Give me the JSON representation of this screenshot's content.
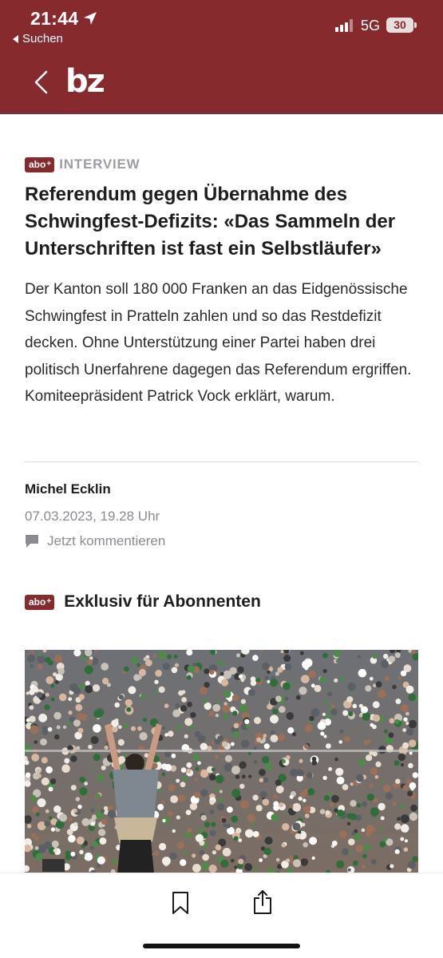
{
  "status_bar": {
    "time": "21:44",
    "back_label": "Suchen",
    "network": "5G",
    "battery": "30"
  },
  "header": {
    "logo": "bz"
  },
  "article": {
    "badge": "abo",
    "badge_plus": "+",
    "kicker": "INTERVIEW",
    "headline": "Referendum gegen Übernahme des Schwingfest-Defizits: «Das Sammeln der Unterschriften ist fast ein Selbstläufer»",
    "lead": "Der Kanton soll 180 000 Franken an das Eidgenössische Schwingfest in Pratteln zahlen und so das Restdefizit decken. Ohne Unterstützung einer Partei haben drei politisch Unerfahrene dagegen das Referendum ergriffen. Komiteepräsident Patrick Vock erklärt, warum.",
    "author": "Michel Ecklin",
    "date": "07.03.2023, 19.28 Uhr",
    "comment_label": "Jetzt kommentieren"
  },
  "exclusive": {
    "badge": "abo",
    "badge_plus": "+",
    "title": "Exklusiv für Abonnenten"
  },
  "colors": {
    "brand": "#862a2e",
    "muted": "#8a8c91"
  },
  "icons": {
    "location": "location-arrow-icon",
    "back": "chevron-left-icon",
    "comment": "speech-bubble-icon",
    "bookmark": "bookmark-icon",
    "share": "share-icon"
  }
}
